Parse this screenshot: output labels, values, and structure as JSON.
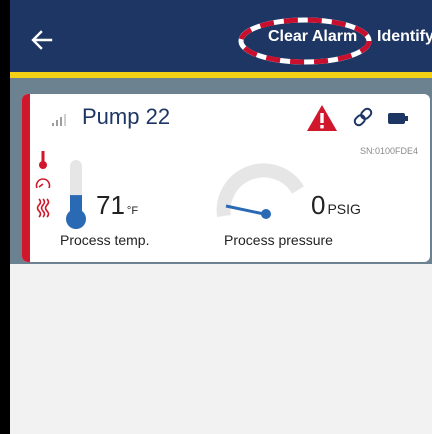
{
  "header": {
    "clear_alarm_label": "Clear Alarm",
    "identify_label": "Identify",
    "icons": {
      "back": "arrow-left-icon"
    }
  },
  "device_card": {
    "name": "Pump 22",
    "serial": "SN:0100FDE4",
    "status_icons": [
      "signal-strength-icon",
      "alarm-warning-icon",
      "link-icon",
      "battery-icon"
    ],
    "side_icons": [
      "temperature-alarm-icon",
      "pressure-alarm-icon",
      "heat-alarm-icon"
    ],
    "temperature": {
      "value": "71",
      "unit": "°F",
      "label": "Process temp.",
      "fill_fraction": 0.35
    },
    "pressure": {
      "value": "0",
      "unit": "PSIG",
      "label": "Process pressure",
      "fill_fraction": 0.0
    }
  },
  "colors": {
    "header_bg": "#1d3664",
    "accent_line": "#f3cf16",
    "alarm_red": "#d0172b",
    "content_bg": "#6d8291",
    "primary_blue": "#2a6ab5",
    "highlight_dash": "#c8102e"
  }
}
